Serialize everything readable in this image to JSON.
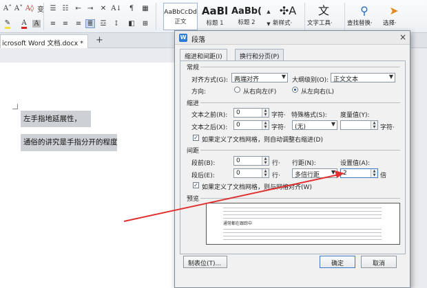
{
  "ribbon": {
    "styles": [
      {
        "preview": "AaBbCcDd",
        "label": "正文"
      },
      {
        "preview": "AaBl",
        "label": "标题 1"
      },
      {
        "preview": "AaBb(",
        "label": "标题 2"
      }
    ],
    "new_style_label": "新样式·",
    "text_tools_label": "文字工具·",
    "find_replace_label": "查找替换·",
    "select_label": "选择·"
  },
  "tabs": {
    "doc_title": "icrosoft Word 文档.docx *",
    "add": "+"
  },
  "document": {
    "line1": "左手指地延展性，",
    "line2": "通俗的讲究是手指分开的程度"
  },
  "dialog": {
    "title": "段落",
    "close": "×",
    "tab_indent": "缩进和间距(I)",
    "tab_breaks": "换行和分页(P)",
    "general": {
      "header": "常规",
      "align_label": "对齐方式(G):",
      "align_value": "两端对齐",
      "outline_label": "大纲级别(O):",
      "outline_value": "正文文本",
      "direction_label": "方向:",
      "rtl_label": "从右向左(F)",
      "ltr_label": "从左向右(L)"
    },
    "indent": {
      "header": "缩进",
      "before_label": "文本之前(R):",
      "before_value": "0",
      "before_unit": "字符·",
      "special_label": "特殊格式(S):",
      "measure_label": "度量值(Y):",
      "after_label": "文本之后(X):",
      "after_value": "0",
      "after_unit": "字符·",
      "special_value": "(无)",
      "measure_unit": "字符·",
      "auto_adjust": "如果定义了文档网格，则自动调整右缩进(D)"
    },
    "spacing": {
      "header": "间距",
      "before_label": "段前(B):",
      "before_value": "0",
      "before_unit": "行·",
      "line_label": "行距(N):",
      "at_label": "设置值(A):",
      "after_label": "段后(E):",
      "after_value": "0",
      "after_unit": "行·",
      "line_value": "多倍行距",
      "at_value": "2",
      "at_unit": "倍",
      "snap_grid": "如果定义了文档网格，则与网格对齐(W)"
    },
    "preview_header": "预览",
    "preview_sample": "通常都在跟踪中",
    "tabs_button": "制表位(T)...",
    "ok_button": "确定",
    "cancel_button": "取消"
  }
}
